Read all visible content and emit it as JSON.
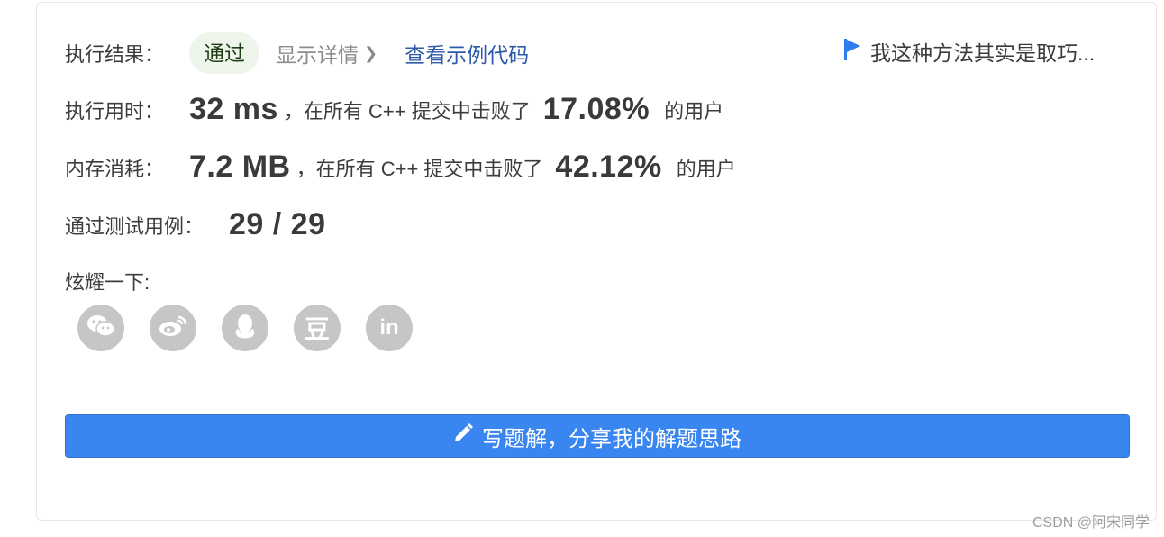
{
  "result": {
    "label": "执行结果：",
    "status": "通过",
    "details_link": "显示详情",
    "view_code_link": "查看示例代码",
    "note": "我这种方法其实是取巧..."
  },
  "runtime": {
    "label": "执行用时：",
    "value": "32 ms",
    "mid_text": "，在所有 C++ 提交中击败了",
    "percent": "17.08%",
    "suffix": "的用户"
  },
  "memory": {
    "label": "内存消耗：",
    "value": "7.2 MB",
    "mid_text": "，在所有 C++ 提交中击败了",
    "percent": "42.12%",
    "suffix": "的用户"
  },
  "tests": {
    "label": "通过测试用例：",
    "value": "29 / 29"
  },
  "share": {
    "label": "炫耀一下:",
    "icons": [
      "wechat-icon",
      "weibo-icon",
      "qq-icon",
      "douban-icon",
      "linkedin-icon"
    ],
    "douban_glyph": "豆",
    "linkedin_glyph": "in"
  },
  "write_button": {
    "label": "写题解，分享我的解题思路"
  },
  "watermark": "CSDN @阿宋同学",
  "colors": {
    "accent": "#3a86f0",
    "pass_bg": "#eef6ec",
    "link": "#2e5aa6",
    "icon_gray": "#c6c6c6"
  }
}
